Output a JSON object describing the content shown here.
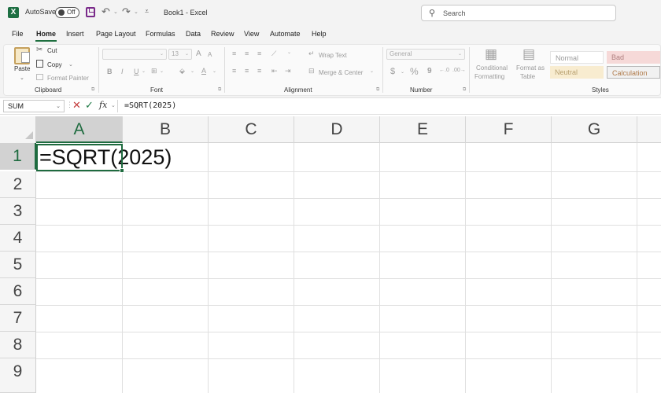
{
  "titlebar": {
    "autosave_label": "AutoSave",
    "autosave_state": "Off",
    "doc_title": "Book1  -  Excel",
    "search_placeholder": "Search",
    "excel_logo": "X"
  },
  "menu": {
    "tabs": [
      "File",
      "Home",
      "Insert",
      "Page Layout",
      "Formulas",
      "Data",
      "Review",
      "View",
      "Automate",
      "Help"
    ],
    "active": "Home"
  },
  "ribbon": {
    "clipboard": {
      "paste_label": "Paste",
      "cut_label": "Cut",
      "copy_label": "Copy",
      "format_painter_label": "Format Painter",
      "group_label": "Clipboard"
    },
    "font": {
      "font_size": "13",
      "grow": "A",
      "shrink": "A",
      "bold": "B",
      "italic": "I",
      "underline": "U",
      "group_label": "Font"
    },
    "alignment": {
      "wrap_text": "Wrap Text",
      "merge_center": "Merge & Center",
      "group_label": "Alignment"
    },
    "number": {
      "format": "General",
      "currency": "$",
      "percent": "%",
      "comma": "9",
      "group_label": "Number"
    },
    "styles": {
      "conditional_formatting": [
        "Conditional",
        "Formatting"
      ],
      "format_as_table": [
        "Format as",
        "Table"
      ],
      "cells": [
        "Normal",
        "Bad",
        "Neutral",
        "Calculation"
      ],
      "group_label": "Styles"
    }
  },
  "formula_bar": {
    "name_box": "SUM",
    "fx": "fx",
    "formula": "=SQRT(2025)"
  },
  "grid": {
    "columns": [
      "A",
      "B",
      "C",
      "D",
      "E",
      "F",
      "G"
    ],
    "rows": [
      "1",
      "2",
      "3",
      "4",
      "5",
      "6",
      "7",
      "8",
      "9"
    ],
    "active_column": "A",
    "active_row": "1",
    "cell_a1": "=SQRT(2025)"
  },
  "colors": {
    "excel_green": "#1e6b3f",
    "save_purple": "#7a2a8a",
    "cancel_red": "#c43e3e"
  }
}
